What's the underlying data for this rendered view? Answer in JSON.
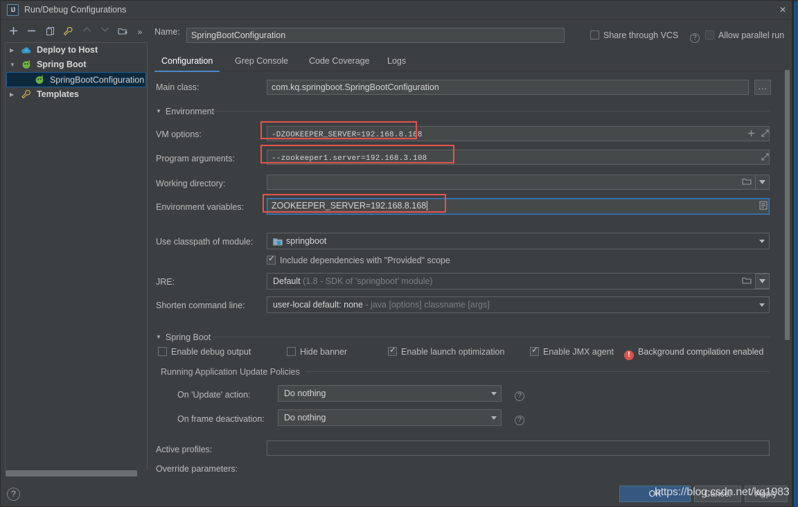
{
  "window": {
    "title": "Run/Debug Configurations",
    "app_icon": "IJ",
    "close_icon": "×"
  },
  "toolbar": {
    "buttons": [
      {
        "name": "add",
        "glyph": "+",
        "enabled": true
      },
      {
        "name": "remove",
        "glyph": "−",
        "enabled": true
      },
      {
        "name": "copy",
        "glyph": "copy-icon",
        "enabled": true
      },
      {
        "name": "edit-templates",
        "glyph": "wrench-icon",
        "enabled": true
      },
      {
        "name": "move-up",
        "glyph": "▲",
        "enabled": false
      },
      {
        "name": "move-down",
        "glyph": "▼",
        "enabled": false
      },
      {
        "name": "new-folder",
        "glyph": "folder-add-icon",
        "enabled": true
      },
      {
        "name": "more",
        "glyph": "»",
        "enabled": true
      }
    ]
  },
  "tree": {
    "items": [
      {
        "label": "Deploy to Host",
        "arrow": "▶",
        "icon": "cloud-icon",
        "selected": false,
        "indent": 0,
        "bold": true
      },
      {
        "label": "Spring Boot",
        "arrow": "▼",
        "icon": "spring-icon",
        "selected": false,
        "indent": 0,
        "bold": true
      },
      {
        "label": "SpringBootConfiguration",
        "arrow": "",
        "icon": "spring-icon",
        "selected": true,
        "indent": 1,
        "bold": false
      },
      {
        "label": "Templates",
        "arrow": "▶",
        "icon": "wrench-icon",
        "selected": false,
        "indent": 0,
        "bold": true
      }
    ]
  },
  "header": {
    "name_label": "Name:",
    "name_value": "SpringBootConfiguration",
    "share_vcs_label": "Share through VCS",
    "share_vcs_checked": false,
    "allow_parallel_label": "Allow parallel run",
    "allow_parallel_checked": false,
    "help_glyph": "?"
  },
  "tabs": [
    {
      "label": "Configuration",
      "active": true
    },
    {
      "label": "Grep Console",
      "active": false
    },
    {
      "label": "Code Coverage",
      "active": false
    },
    {
      "label": "Logs",
      "active": false
    }
  ],
  "form": {
    "main_class_label": "Main class:",
    "main_class_value": "com.kq.springboot.SpringBootConfiguration",
    "main_class_browse": "...",
    "environment_section": "Environment",
    "vm_options_label": "VM options:",
    "vm_options_value": "-DZOOKEEPER_SERVER=192.168.8.168",
    "program_args_label": "Program arguments:",
    "program_args_value": "--zookeeper1.server=192.168.3.108",
    "working_dir_label": "Working directory:",
    "working_dir_value": "",
    "env_vars_label": "Environment variables:",
    "env_vars_value": "ZOOKEEPER_SERVER=192.168.8.168",
    "classpath_label": "Use classpath of module:",
    "classpath_value": "springboot",
    "include_provided_label": "Include dependencies with \"Provided\" scope",
    "include_provided_checked": true,
    "jre_label": "JRE:",
    "jre_value": "Default",
    "jre_hint": "(1.8 - SDK of 'springboot' module)",
    "shorten_label": "Shorten command line:",
    "shorten_value": "user-local default: none",
    "shorten_hint": "- java [options] classname [args]"
  },
  "springboot": {
    "section_title": "Spring Boot",
    "checkboxes": [
      {
        "label": "Enable debug output",
        "checked": false
      },
      {
        "label": "Hide banner",
        "checked": false
      },
      {
        "label": "Enable launch optimization",
        "checked": true
      },
      {
        "label": "Enable JMX agent",
        "checked": true
      }
    ],
    "error_icon": "!",
    "error_text": "Background compilation enabled",
    "policies_title": "Running Application Update Policies",
    "on_update_label": "On 'Update' action:",
    "on_update_value": "Do nothing",
    "on_frame_label": "On frame deactivation:",
    "on_frame_value": "Do nothing",
    "help_glyph": "?"
  },
  "profiles": {
    "active_profiles_label": "Active profiles:",
    "active_profiles_value": "",
    "override_params_label": "Override parameters:"
  },
  "footer": {
    "ok_label": "OK",
    "cancel_label": "Cancel",
    "apply_label": "Apply",
    "help_label": "Help",
    "bottom_help_glyph": "?",
    "watermark": "https://blog.csdn.net/kq1983"
  },
  "colors": {
    "background": "#3c3f41",
    "field": "#45494a",
    "accent": "#4e86c8",
    "selection": "#0d293e",
    "highlight_box": "#e8544a",
    "ok_button": "#365880",
    "error": "#d9534f"
  }
}
